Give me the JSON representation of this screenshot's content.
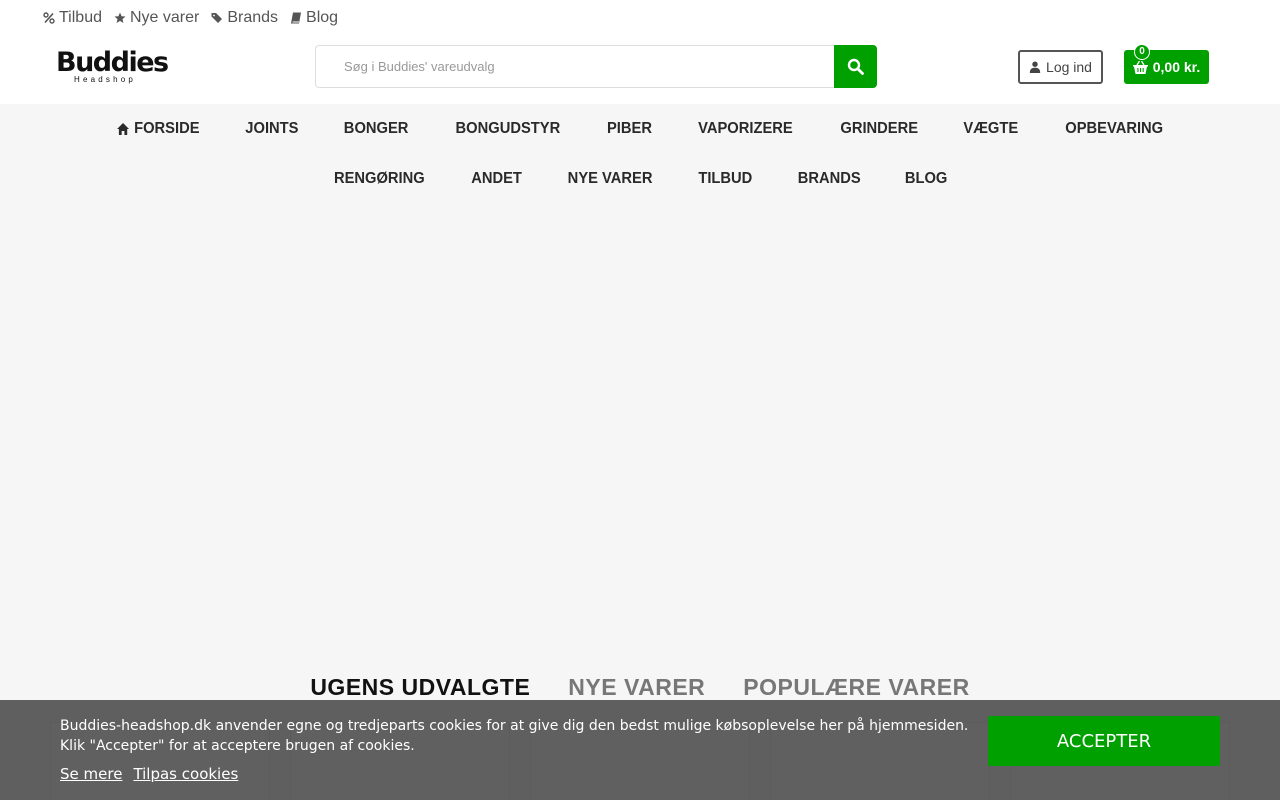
{
  "toplinks": [
    {
      "label": "Tilbud",
      "icon": "percent-icon"
    },
    {
      "label": "Nye varer",
      "icon": "star-icon"
    },
    {
      "label": "Brands",
      "icon": "tags-icon"
    },
    {
      "label": "Blog",
      "icon": "book-icon"
    }
  ],
  "logo": {
    "main": "Buddies",
    "sub": "Headshop"
  },
  "search": {
    "placeholder": "Søg i Buddies' vareudvalg",
    "value": ""
  },
  "account": {
    "login_label": "Log ind"
  },
  "cart": {
    "count": "0",
    "total": "0,00 kr."
  },
  "nav": {
    "row1": [
      "FORSIDE",
      "JOINTS",
      "BONGER",
      "BONGUDSTYR",
      "PIBER",
      "VAPORIZERE",
      "GRINDERE",
      "VÆGTE",
      "OPBEVARING"
    ],
    "row2": [
      "RENGØRING",
      "ANDET",
      "NYE VARER",
      "TILBUD",
      "BRANDS",
      "BLOG"
    ]
  },
  "product_tabs": [
    "UGENS UDVALGTE",
    "NYE VARER",
    "POPULÆRE VARER"
  ],
  "cookie": {
    "text": "Buddies-headshop.dk anvender egne og tredjeparts cookies for at give dig den bedst mulige købsoplevelse her på hjemmesiden. Klik \"Accepter\" for at acceptere brugen af cookies.",
    "more_label": "Se mere",
    "customize_label": "Tilpas cookies",
    "accept_label": "ACCEPTER"
  },
  "colors": {
    "accent": "#00a000",
    "page_bg": "#f6f6f6",
    "header_bg": "#ffffff"
  }
}
